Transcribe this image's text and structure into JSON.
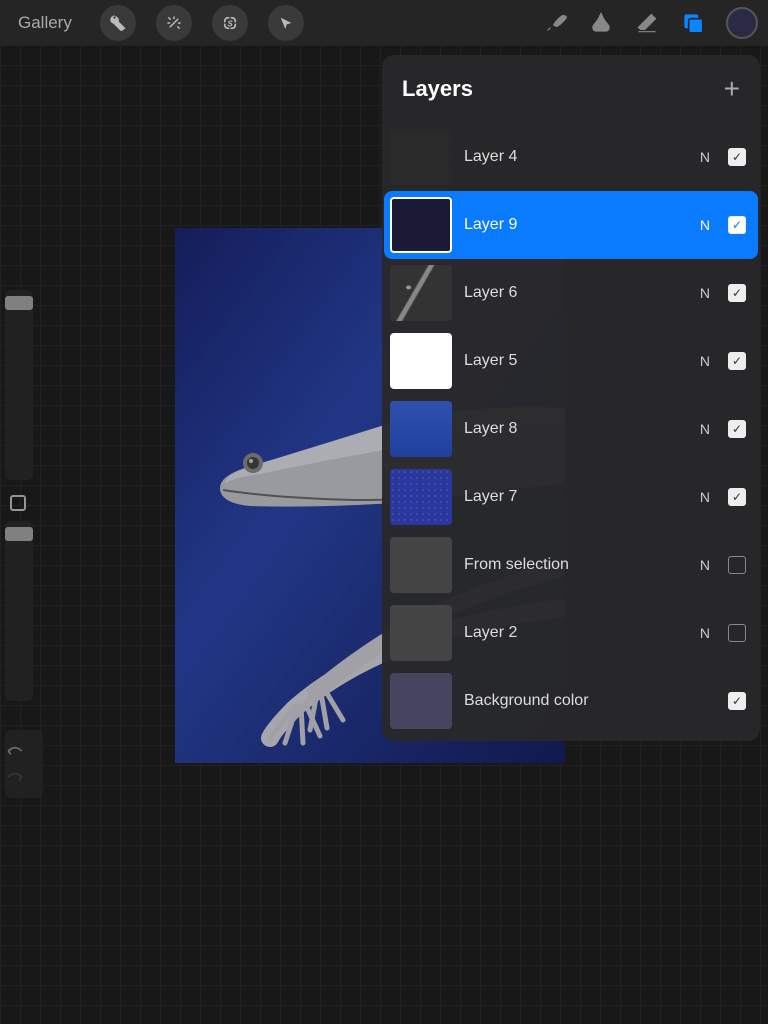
{
  "toolbar": {
    "gallery": "Gallery"
  },
  "panel": {
    "title": "Layers"
  },
  "layers": [
    {
      "name": "Layer 4",
      "blend": "N",
      "checked": true,
      "selected": false,
      "thumb": "thumb-dark"
    },
    {
      "name": "Layer 9",
      "blend": "N",
      "checked": true,
      "selected": true,
      "thumb": "thumb-navy"
    },
    {
      "name": "Layer 6",
      "blend": "N",
      "checked": true,
      "selected": false,
      "thumb": "thumb-limbs"
    },
    {
      "name": "Layer 5",
      "blend": "N",
      "checked": true,
      "selected": false,
      "thumb": "thumb-white-body"
    },
    {
      "name": "Layer 8",
      "blend": "N",
      "checked": true,
      "selected": false,
      "thumb": "thumb-blue-grad"
    },
    {
      "name": "Layer 7",
      "blend": "N",
      "checked": true,
      "selected": false,
      "thumb": "thumb-blue-noise"
    },
    {
      "name": "From selection",
      "blend": "N",
      "checked": false,
      "selected": false,
      "thumb": "thumb-gray"
    },
    {
      "name": "Layer 2",
      "blend": "N",
      "checked": false,
      "selected": false,
      "thumb": "thumb-gray"
    },
    {
      "name": "Background color",
      "blend": "",
      "checked": true,
      "selected": false,
      "thumb": "thumb-bgcolor"
    }
  ],
  "colors": {
    "accent": "#0a7aff",
    "current_color": "#2a2a45"
  }
}
